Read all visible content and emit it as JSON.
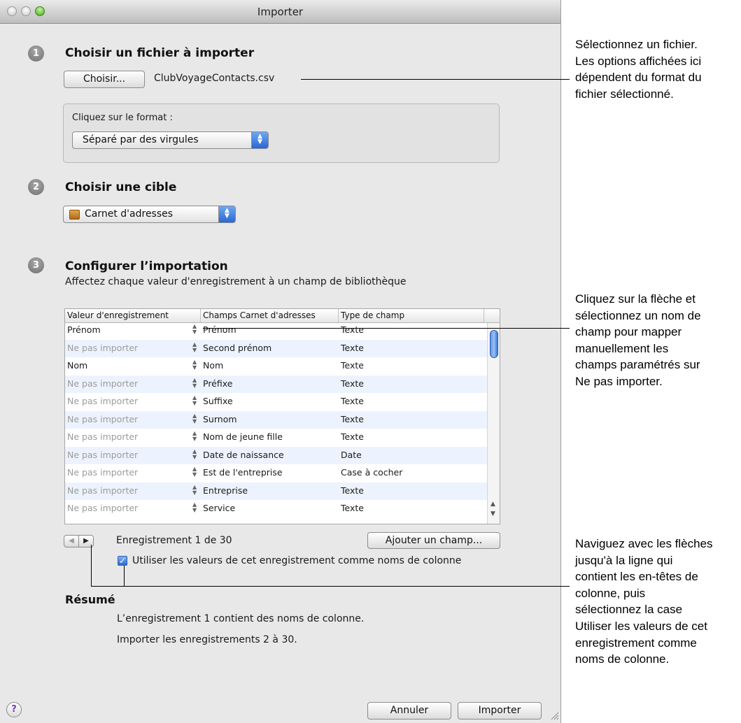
{
  "window": {
    "title": "Importer"
  },
  "step1": {
    "number": "1",
    "title": "Choisir un fichier à importer",
    "choose_button": "Choisir...",
    "file_name": "ClubVoyageContacts.csv",
    "format_label": "Cliquez sur le format :",
    "format_value": "Séparé par des virgules"
  },
  "step2": {
    "number": "2",
    "title": "Choisir une cible",
    "target_value": "Carnet d'adresses"
  },
  "step3": {
    "number": "3",
    "title": "Configurer l’importation",
    "subtitle": "Affectez chaque valeur d'enregistrement à un champ de bibliothèque",
    "columns": [
      "Valeur d'enregistrement",
      "Champs Carnet d'adresses",
      "Type de champ"
    ],
    "rows": [
      {
        "value": "Prénom",
        "muted": false,
        "field": "Prénom",
        "type": "Texte"
      },
      {
        "value": "Ne pas importer",
        "muted": true,
        "field": "Second prénom",
        "type": "Texte"
      },
      {
        "value": "Nom",
        "muted": false,
        "field": "Nom",
        "type": "Texte"
      },
      {
        "value": "Ne pas importer",
        "muted": true,
        "field": "Préfixe",
        "type": "Texte"
      },
      {
        "value": "Ne pas importer",
        "muted": true,
        "field": "Suffixe",
        "type": "Texte"
      },
      {
        "value": "Ne pas importer",
        "muted": true,
        "field": "Surnom",
        "type": "Texte"
      },
      {
        "value": "Ne pas importer",
        "muted": true,
        "field": "Nom de jeune fille",
        "type": "Texte"
      },
      {
        "value": "Ne pas importer",
        "muted": true,
        "field": "Date de naissance",
        "type": "Date"
      },
      {
        "value": "Ne pas importer",
        "muted": true,
        "field": "Est de l'entreprise",
        "type": "Case à cocher"
      },
      {
        "value": "Ne pas importer",
        "muted": true,
        "field": "Entreprise",
        "type": "Texte"
      },
      {
        "value": "Ne pas importer",
        "muted": true,
        "field": "Service",
        "type": "Texte"
      }
    ],
    "record_label": "Enregistrement 1 de 30",
    "add_field_button": "Ajouter un champ...",
    "use_as_headers_label": "Utiliser les valeurs de cet enregistrement comme noms de colonne",
    "use_as_headers_checked": true
  },
  "summary": {
    "title": "Résumé",
    "line1": "L’enregistrement 1 contient des noms de colonne.",
    "line2": "Importer les enregistrements 2 à 30."
  },
  "buttons": {
    "cancel": "Annuler",
    "import": "Importer",
    "help": "?"
  },
  "annotations": {
    "file": [
      "Sélectionnez un fichier.",
      "Les options affichées ici",
      "dépendent du format du",
      "fichier sélectionné."
    ],
    "mapping": [
      "Cliquez sur la flèche et",
      "sélectionnez un nom de",
      "champ pour mapper",
      "manuellement les",
      "champs paramétrés sur",
      "Ne pas importer."
    ],
    "navigate": [
      "Naviguez avec les flèches",
      "jusqu'à la ligne qui",
      "contient les en-têtes de",
      "colonne, puis",
      "sélectionnez la case",
      "Utiliser les valeurs de cet",
      "enregistrement comme",
      "noms de colonne."
    ]
  },
  "colors": {
    "accent_blue": "#2c6ad6",
    "window_bg": "#e8e8e8",
    "row_alt": "#edf3fe",
    "muted_text": "#9b9b9b"
  }
}
